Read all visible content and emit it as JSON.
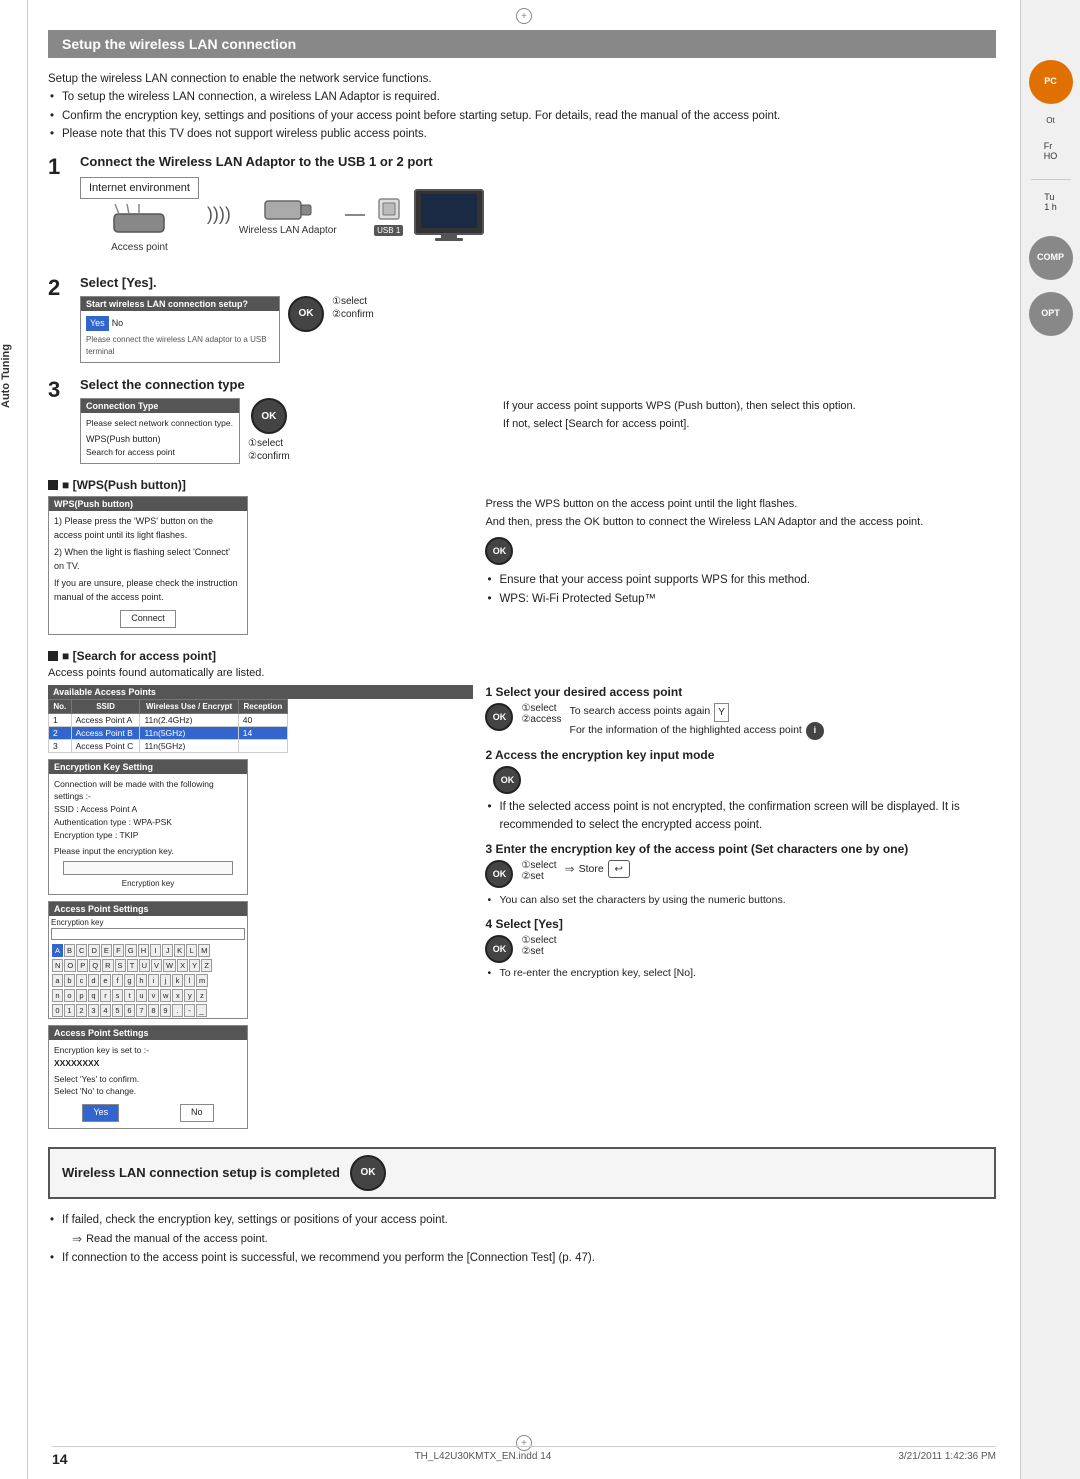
{
  "page": {
    "number": "14",
    "filename": "TH_L42U30KMTX_EN.indd  14",
    "date": "3/21/2011  1:42:36 PM"
  },
  "header": {
    "title": "Setup the wireless LAN connection"
  },
  "intro": {
    "line1": "Setup the wireless LAN connection to enable the network service functions.",
    "bullet1": "To setup the wireless LAN connection, a wireless LAN Adaptor is required.",
    "bullet2": "Confirm the encryption key, settings and positions of your access point before starting setup. For details, read the manual of the access point.",
    "bullet3": "Please note that this TV does not support wireless public access points."
  },
  "steps": {
    "step1": {
      "number": "1",
      "title": "Connect the Wireless LAN Adaptor to the USB 1 or 2 port",
      "diagram": {
        "box_label": "Internet environment",
        "access_point_label": "Access point",
        "adaptor_label": "Wireless LAN Adaptor",
        "usb_label": "USB 1"
      }
    },
    "step2": {
      "number": "2",
      "title": "Select [Yes].",
      "screen": {
        "header": "Start wireless LAN connection setup?",
        "row1": "Yes",
        "row2": "No",
        "note": "Please connect the wireless LAN adaptor to a USB terminal"
      },
      "select_label": "①select",
      "confirm_label": "②confirm"
    },
    "step3": {
      "number": "3",
      "title": "Select the connection type",
      "screen": {
        "header": "Connection Type",
        "line1": "Please select network connection type.",
        "option1": "WPS(Push button)",
        "option2": "Search for access point"
      },
      "select_label": "①select",
      "confirm_label": "②confirm",
      "note1": "If your access point supports WPS (Push button), then select this option.",
      "note2": "If not, select [Search for access point]."
    },
    "wps_section": {
      "title": "■ [WPS(Push button)]",
      "screen": {
        "header": "WPS(Push button)",
        "line1": "1) Please press the 'WPS' button on the access point until its light flashes.",
        "line2": "2) When the light is flashing select 'Connect' on TV.",
        "line3": "If you are unsure, please check the instruction manual of the access point.",
        "btn_label": "Connect"
      },
      "desc1": "Press the WPS button on the access point until the light flashes.",
      "desc2": "And then, press the OK button to connect the Wireless LAN Adaptor and the access point.",
      "note1": "Ensure that your access point supports WPS for this method.",
      "note2": "WPS: Wi-Fi Protected Setup™"
    },
    "search_section": {
      "title": "■ [Search for access point]",
      "subtitle": "Access points found automatically are listed.",
      "step1_title": "1 Select your desired access point",
      "step1_select": "①select",
      "step1_access": "②access",
      "note1": "To search access points again",
      "note2": "For the information of the highlighted access point",
      "table": {
        "title": "Available Access Points",
        "headers": [
          "No.",
          "SSID",
          "Wireless Use / Encrypt",
          "Reception"
        ],
        "rows": [
          [
            "1",
            "Access Point A",
            "11n(2.4GHz)",
            "40",
            ""
          ],
          [
            "2",
            "Access Point B",
            "11n(5GHz)",
            "14",
            ""
          ],
          [
            "3",
            "Access Point C",
            "11n(5GHz)",
            "",
            ""
          ]
        ]
      },
      "step2_title": "2 Access the encryption key input mode",
      "enc_screen": {
        "header": "Encryption Key Setting",
        "line1": "Connection will be made with the following settings :-",
        "line2": "SSID : Access Point A",
        "line3": "Authentication type : WPA-PSK",
        "line4": "Encryption type : TKIP",
        "line5": "Please input the encryption key.",
        "input_label": "Encryption key"
      },
      "enc_note1": "If the selected access point is not encrypted, the confirmation screen will be displayed. It is recommended to select the encrypted access point.",
      "step3_title": "3 Enter the encryption key of the access point (Set characters one by one)",
      "step3_select": "①select",
      "step3_set": "②set",
      "store_label": "Store",
      "step3_note": "You can also set the characters by using the numeric buttons.",
      "ap_settings_screen": {
        "header": "Access Point Settings",
        "input_label": "Encryption key"
      },
      "keyboard_screen": {
        "header": "Access Point Settings",
        "rows": [
          [
            "A",
            "B",
            "C",
            "D",
            "E",
            "F",
            "G",
            "H",
            "I",
            "J",
            "K",
            "L",
            "M"
          ],
          [
            "N",
            "O",
            "P",
            "Q",
            "R",
            "S",
            "T",
            "U",
            "V",
            "W",
            "X",
            "Y",
            "Z"
          ],
          [
            "a",
            "b",
            "c",
            "d",
            "e",
            "f",
            "g",
            "h",
            "i",
            "j",
            "k",
            "l",
            "m"
          ],
          [
            "n",
            "o",
            "p",
            "q",
            "r",
            "s",
            "t",
            "u",
            "v",
            "w",
            "x",
            "y",
            "z"
          ],
          [
            "0",
            "1",
            "2",
            "3",
            "4",
            "5",
            "6",
            "7",
            "8",
            "9",
            ".",
            "-",
            "_"
          ]
        ]
      },
      "step4_title": "4 Select [Yes]",
      "step4_select": "①select",
      "step4_set": "②set",
      "step4_note": "To re-enter the encryption key, select [No].",
      "yes_no_screen": {
        "header": "Access Point Settings",
        "line1": "Encryption key is set to :-",
        "line2": "XXXXXXXX",
        "line3": "Select 'Yes' to confirm.",
        "line4": "Select 'No' to change.",
        "btn_yes": "Yes",
        "btn_no": "No"
      }
    }
  },
  "completed": {
    "title": "Wireless LAN connection setup is completed",
    "note1": "If failed, check the encryption key, settings or positions of your access point.",
    "note2": "Read the manual of the access point.",
    "note3": "If connection to the access point is successful, we recommend you perform the [Connection Test] (p. 47)."
  },
  "sidebar": {
    "label": "Auto Tuning",
    "items": [
      {
        "label": "PC",
        "type": "orange"
      },
      {
        "label": "COMP",
        "type": "gray"
      },
      {
        "label": "OPT",
        "type": "gray"
      }
    ]
  },
  "right_sidebar": {
    "items": [
      {
        "label": "Fr",
        "sub": "HO"
      },
      {
        "label": "Tu",
        "sub": "1 h"
      }
    ]
  }
}
